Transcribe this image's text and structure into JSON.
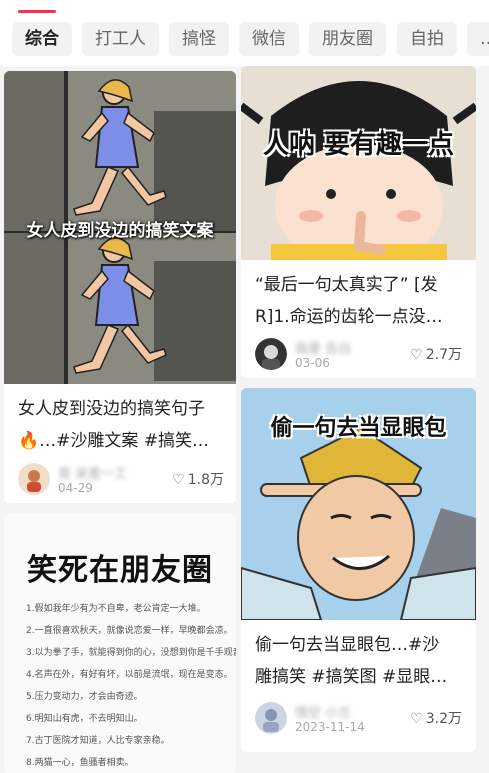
{
  "tabs": [
    {
      "label": "综合",
      "active": true
    },
    {
      "label": "打工人"
    },
    {
      "label": "搞怪"
    },
    {
      "label": "微信"
    },
    {
      "label": "朋友圈"
    },
    {
      "label": "自拍"
    },
    {
      "label": "…"
    }
  ],
  "left_column": [
    {
      "cover_caption": "女人皮到没边的搞笑文案",
      "title_line1": "女人皮到没边的搞笑句子",
      "title_line2": "🔥…#沙雕文案 #搞笑…",
      "author": "易 呆是一工",
      "date": "04-29",
      "likes": "1.8万"
    },
    {
      "cover_heading": "笑死在朋友圈",
      "cover_lines": [
        "1.假如我年少有为不自卑，老公肯定一大堆。",
        "2.一直很喜欢秋天，就像说恋爱一样，早晚都会凉。",
        "3.以为拳了手，就能得到你的心，没想到你是千手观音。",
        "4.名声在外，有好有坏，以前是流氓，现在是变态。",
        "5.压力变动力，才会由奇迹。",
        "6.明知山有虎，不去明知山。",
        "7.古丁医院才知道，人比专家亲稳。",
        "8.两猫一心，鱼骚者相卖。"
      ]
    }
  ],
  "right_column": [
    {
      "cover_caption": "人呐 要有趣一点",
      "title_line1": "“最后一句太真实了” [发",
      "title_line2": "R]1.命运的齿轮一点没…",
      "author": "我是 告白",
      "date": "03-06",
      "likes": "2.7万"
    },
    {
      "cover_caption": "偷一句去当显眼包",
      "title_line1": "偷一句去当显眼包…#沙",
      "title_line2": "雕搞笑 #搞笑图 #显眼…",
      "author": "悟空 小兰",
      "date": "2023-11-14",
      "likes": "3.2万"
    }
  ],
  "icons": {
    "like": "heart-outline-icon"
  },
  "colors": {
    "accent": "#ff2d4b"
  }
}
